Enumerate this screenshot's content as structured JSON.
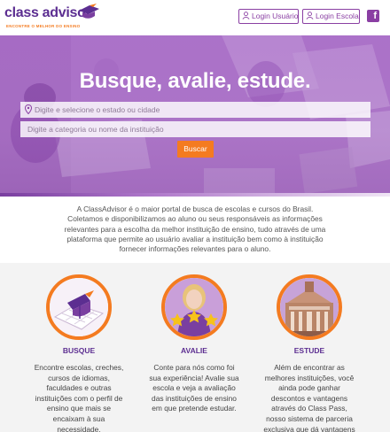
{
  "header": {
    "logo_text": "class advisor",
    "logo_tagline": "ENCONTRE O MELHOR DO ENSINO",
    "login_user_label": "Login Usuário",
    "login_school_label": "Login Escola",
    "facebook_icon": "facebook-icon"
  },
  "hero": {
    "title": "Busque, avalie, estude.",
    "state_placeholder": "Digite e selecione o estado ou cidade",
    "category_placeholder": "Digite a categoria ou nome da instituição",
    "search_label": "Buscar"
  },
  "about": {
    "lines": [
      "A ClassAdvisor é o maior portal de busca de escolas e cursos do Brasil.",
      "Coletamos e disponibilizamos ao aluno ou seus responsáveis as informações",
      "relevantes para a escolha da melhor instituição de ensino, tudo através de uma",
      "plataforma que permite ao usuário avaliar a instituição bem como à instituição",
      "fornecer informações relevantes para o aluno."
    ]
  },
  "features": [
    {
      "title": "BUSQUE",
      "icon": "map-search-icon",
      "lines": [
        "Encontre escolas, creches,",
        "cursos de idiomas,",
        "faculdades e outras",
        "instituições com o perfil de",
        "ensino que mais se",
        "encaixam à sua",
        "necessidade."
      ]
    },
    {
      "title": "AVALIE",
      "icon": "student-rating-icon",
      "lines": [
        "Conte para nós como foi",
        "sua experiência! Avalie sua",
        "escola e veja a avaliação",
        "das instituições de ensino",
        "em que pretende estudar."
      ]
    },
    {
      "title": "ESTUDE",
      "icon": "university-building-icon",
      "lines": [
        "Além de encontrar as",
        "melhores instituições, você",
        "ainda pode ganhar",
        "descontos e vantagens",
        "através do Class Pass,",
        "nosso sistema de parceria",
        "exclusiva que dá vantagens"
      ]
    }
  ],
  "colors": {
    "brand_purple": "#5c2e91",
    "accent_orange": "#f47b20",
    "hero_overlay": "#9a55c0"
  }
}
